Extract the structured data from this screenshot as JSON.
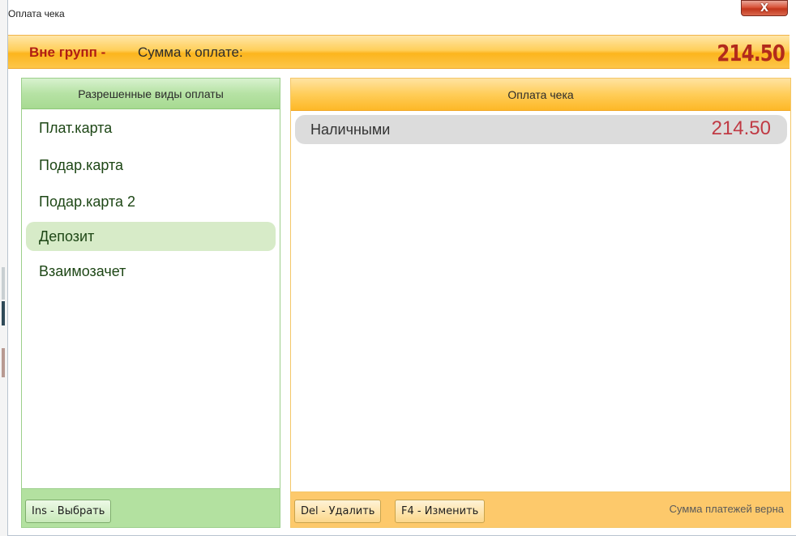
{
  "window": {
    "title": "Оплата чека",
    "close_glyph": "X"
  },
  "header": {
    "group_name": "Вне групп -",
    "sum_label": "Сумма к оплате:",
    "total_amount": "214.50"
  },
  "left_panel": {
    "title": "Разрешенные виды оплаты",
    "items": [
      {
        "label": "Плат.карта",
        "selected": false
      },
      {
        "label": "Подар.карта",
        "selected": false
      },
      {
        "label": "Подар.карта 2",
        "selected": false
      },
      {
        "label": "Депозит",
        "selected": true
      },
      {
        "label": "Взаимозачет",
        "selected": false
      }
    ],
    "select_button": "Ins - Выбрать"
  },
  "right_panel": {
    "title": "Оплата чека",
    "payments": [
      {
        "method": "Наличными",
        "amount": "214.50"
      }
    ],
    "delete_button": "Del - Удалить",
    "edit_button": "F4 - Изменить",
    "status": "Сумма платежей верна"
  },
  "colors": {
    "accent_orange": "#fcb51d",
    "accent_green": "#b3e1a0",
    "amount_red": "#b22a1c",
    "list_text_green": "#1e4716"
  }
}
